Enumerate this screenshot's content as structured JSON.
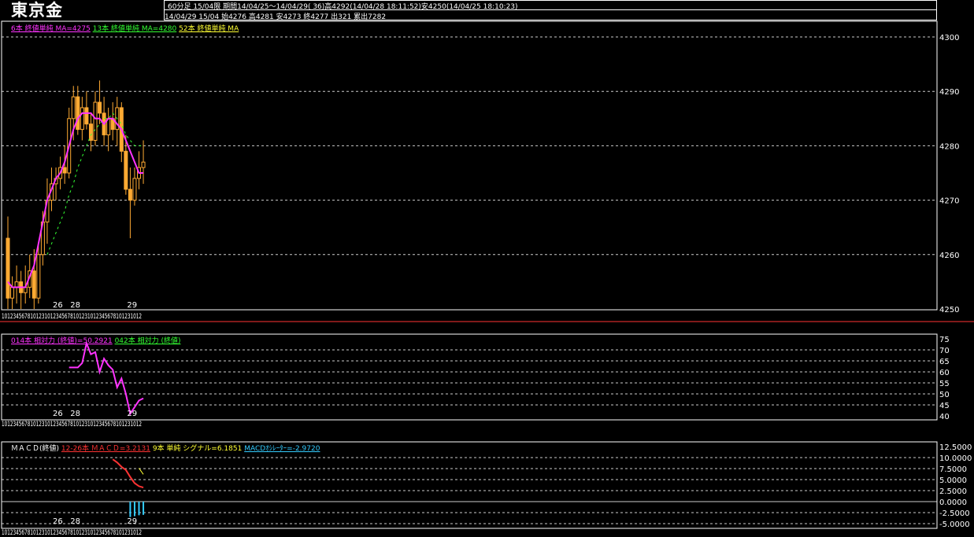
{
  "header": {
    "title": "東京金",
    "line1": "60分足 15/04限  期間14/04/25～14/04/29( 36)高4292(14/04/28 18:11:52)安4250(14/04/25 18:10:23)",
    "line2": "14/04/29 15/04 始4276 高4281 安4273 終4277 出321 累出7282"
  },
  "legends": {
    "price": [
      {
        "text": "6本 終値単純 MA=4275",
        "color": "#ff33ff"
      },
      {
        "text": "13本 終値単純 MA=4280",
        "color": "#33ff33"
      },
      {
        "text": "52本 終値単純 MA",
        "color": "#ffff33"
      }
    ],
    "rsi": [
      {
        "text": "014本 相対力 (終値)=50.2921",
        "color": "#ff33ff"
      },
      {
        "text": "042本 相対力 (終値)",
        "color": "#33ff33"
      }
    ],
    "macd": [
      {
        "text": "ＭＡＣＤ(終値)",
        "color": "#ffffff"
      },
      {
        "text": "12-26本 ＭＡＣＤ=3.2131",
        "color": "#ff3333"
      },
      {
        "text": "9本 単純 シグナル=6.1851",
        "color": "#ffff33"
      },
      {
        "text": "MACDｵｼﾚｰﾀｰ=-2.9720",
        "color": "#33ccff"
      }
    ]
  },
  "xaxis": {
    "hour_ticks": "1012345678101231012345678101231012345678101231012",
    "date_labels": [
      {
        "label": "26",
        "index": 11
      },
      {
        "label": "28",
        "index": 15
      },
      {
        "label": "29",
        "index": 28
      }
    ]
  },
  "chart_data": [
    {
      "type": "candlestick",
      "title": "東京金 60分足",
      "ylim": [
        4250,
        4300
      ],
      "yticks": [
        4250,
        4260,
        4270,
        4280,
        4290,
        4300
      ],
      "colors": {
        "candle": "#ffaa33",
        "ma6": "#ff33ff",
        "ma13": "#33ff33",
        "grid": "#ffffff"
      },
      "candles": [
        {
          "o": 4263,
          "h": 4267,
          "l": 4250,
          "c": 4252
        },
        {
          "o": 4252,
          "h": 4256,
          "l": 4250,
          "c": 4254
        },
        {
          "o": 4254,
          "h": 4258,
          "l": 4251,
          "c": 4255
        },
        {
          "o": 4255,
          "h": 4257,
          "l": 4250,
          "c": 4253
        },
        {
          "o": 4253,
          "h": 4258,
          "l": 4251,
          "c": 4254
        },
        {
          "o": 4254,
          "h": 4260,
          "l": 4252,
          "c": 4257
        },
        {
          "o": 4257,
          "h": 4261,
          "l": 4250,
          "c": 4252
        },
        {
          "o": 4252,
          "h": 4262,
          "l": 4251,
          "c": 4260
        },
        {
          "o": 4260,
          "h": 4268,
          "l": 4258,
          "c": 4266
        },
        {
          "o": 4266,
          "h": 4274,
          "l": 4262,
          "c": 4270
        },
        {
          "o": 4270,
          "h": 4276,
          "l": 4268,
          "c": 4273
        },
        {
          "o": 4273,
          "h": 4276,
          "l": 4270,
          "c": 4274
        },
        {
          "o": 4274,
          "h": 4278,
          "l": 4272,
          "c": 4276
        },
        {
          "o": 4276,
          "h": 4280,
          "l": 4273,
          "c": 4275
        },
        {
          "o": 4275,
          "h": 4287,
          "l": 4274,
          "c": 4285
        },
        {
          "o": 4285,
          "h": 4291,
          "l": 4281,
          "c": 4289
        },
        {
          "o": 4289,
          "h": 4291,
          "l": 4282,
          "c": 4283
        },
        {
          "o": 4283,
          "h": 4289,
          "l": 4281,
          "c": 4287
        },
        {
          "o": 4287,
          "h": 4290,
          "l": 4283,
          "c": 4284
        },
        {
          "o": 4284,
          "h": 4286,
          "l": 4279,
          "c": 4281
        },
        {
          "o": 4281,
          "h": 4290,
          "l": 4280,
          "c": 4288
        },
        {
          "o": 4288,
          "h": 4292,
          "l": 4284,
          "c": 4286
        },
        {
          "o": 4286,
          "h": 4289,
          "l": 4280,
          "c": 4282
        },
        {
          "o": 4282,
          "h": 4287,
          "l": 4279,
          "c": 4285
        },
        {
          "o": 4285,
          "h": 4288,
          "l": 4281,
          "c": 4283
        },
        {
          "o": 4283,
          "h": 4289,
          "l": 4280,
          "c": 4287
        },
        {
          "o": 4287,
          "h": 4288,
          "l": 4277,
          "c": 4279
        },
        {
          "o": 4279,
          "h": 4282,
          "l": 4271,
          "c": 4272
        },
        {
          "o": 4272,
          "h": 4276,
          "l": 4263,
          "c": 4270
        },
        {
          "o": 4270,
          "h": 4276,
          "l": 4269,
          "c": 4274
        },
        {
          "o": 4274,
          "h": 4279,
          "l": 4272,
          "c": 4276
        },
        {
          "o": 4276,
          "h": 4281,
          "l": 4273,
          "c": 4277
        }
      ],
      "ma6": [
        4255,
        4254,
        4254,
        4254,
        4254,
        4256,
        4258,
        4262,
        4266,
        4270,
        4272,
        4274,
        4275,
        4277,
        4280,
        4283,
        4285,
        4286,
        4286,
        4286,
        4285,
        4285,
        4284,
        4285,
        4285,
        4284,
        4283,
        4281,
        4279,
        4277,
        4275,
        4275
      ],
      "ma13": [
        null,
        null,
        null,
        null,
        null,
        null,
        null,
        null,
        null,
        4260,
        4262,
        4264,
        4266,
        4268,
        4271,
        4273,
        4276,
        4278,
        4280,
        4282,
        4283,
        4284,
        4285,
        4285,
        4286,
        4285,
        4284,
        4282,
        4281,
        4280,
        4280,
        4280
      ]
    },
    {
      "type": "line",
      "title": "相対力",
      "ylim": [
        40,
        75
      ],
      "yticks": [
        40,
        45,
        50,
        55,
        60,
        65,
        70,
        75
      ],
      "series": [
        {
          "name": "014本 相対力 (終値)",
          "color": "#ff33ff",
          "x": [
            14,
            15,
            16,
            17,
            18,
            19,
            20,
            21,
            22,
            23,
            24,
            25,
            26,
            27,
            28,
            29,
            30,
            31
          ],
          "values": [
            62,
            62,
            62,
            64,
            73,
            68,
            69,
            60,
            66,
            63,
            61,
            53,
            57,
            50,
            41,
            44,
            47,
            48
          ]
        }
      ]
    },
    {
      "type": "line",
      "title": "ＭＡＣＤ(終値)",
      "ylim": [
        -5,
        12.5
      ],
      "yticks": [
        12.5,
        10,
        7.5,
        5,
        2.5,
        0,
        -2.5,
        -5
      ],
      "ytick_labels": [
        "12.5000",
        "10.0000",
        "7.5000",
        "5.0000",
        "2.5000",
        "0.0000",
        "-2.5000",
        "-5.0000"
      ],
      "series": [
        {
          "name": "12-26本 ＭＡＣＤ",
          "color": "#ff3333",
          "x": [
            24,
            25,
            26,
            27,
            28,
            29,
            30,
            31
          ],
          "values": [
            9.6,
            8.9,
            7.9,
            7.2,
            5.6,
            4.2,
            3.5,
            3.2
          ]
        },
        {
          "name": "9本 単純 シグナル",
          "color": "#ffff33",
          "x": [
            30,
            31
          ],
          "values": [
            7.6,
            6.2
          ]
        },
        {
          "name": "MACDｵｼﾚｰﾀｰ",
          "color": "#33ccff",
          "type": "bar",
          "x": [
            28,
            29,
            30,
            31
          ],
          "values": [
            -3.5,
            -3.3,
            -3.1,
            -3.0
          ]
        }
      ]
    }
  ]
}
